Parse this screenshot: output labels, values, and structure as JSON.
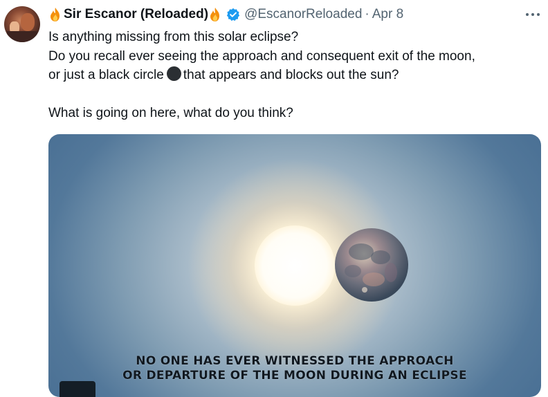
{
  "tweet": {
    "display_name": "Sir Escanor (Reloaded)",
    "handle": "@EscanorReloaded",
    "separator": "·",
    "date": "Apr 8",
    "more_label": "More",
    "text_line1": "Is anything missing from this solar eclipse?",
    "text_line2": "Do you recall ever  seeing the approach and consequent exit of the moon,",
    "text_line3a": "or just a black circle",
    "text_line3b": "that appears and blocks out the sun?",
    "text_line4": "What is going on here, what do you think?",
    "media": {
      "caption_line1": "NO ONE HAS EVER WITNESSED THE APPROACH",
      "caption_line2": "OR DEPARTURE OF THE MOON DURING AN ECLIPSE"
    }
  },
  "icons": {
    "fire_left": "fire-icon",
    "fire_right": "fire-icon",
    "verified": "verified-badge-icon",
    "more": "more-dots-icon",
    "black_circle": "black-circle-emoji"
  },
  "colors": {
    "text": "#0f1419",
    "secondary": "#536471",
    "verified_blue": "#1d9bf0",
    "sky": "#5a7fa2"
  }
}
